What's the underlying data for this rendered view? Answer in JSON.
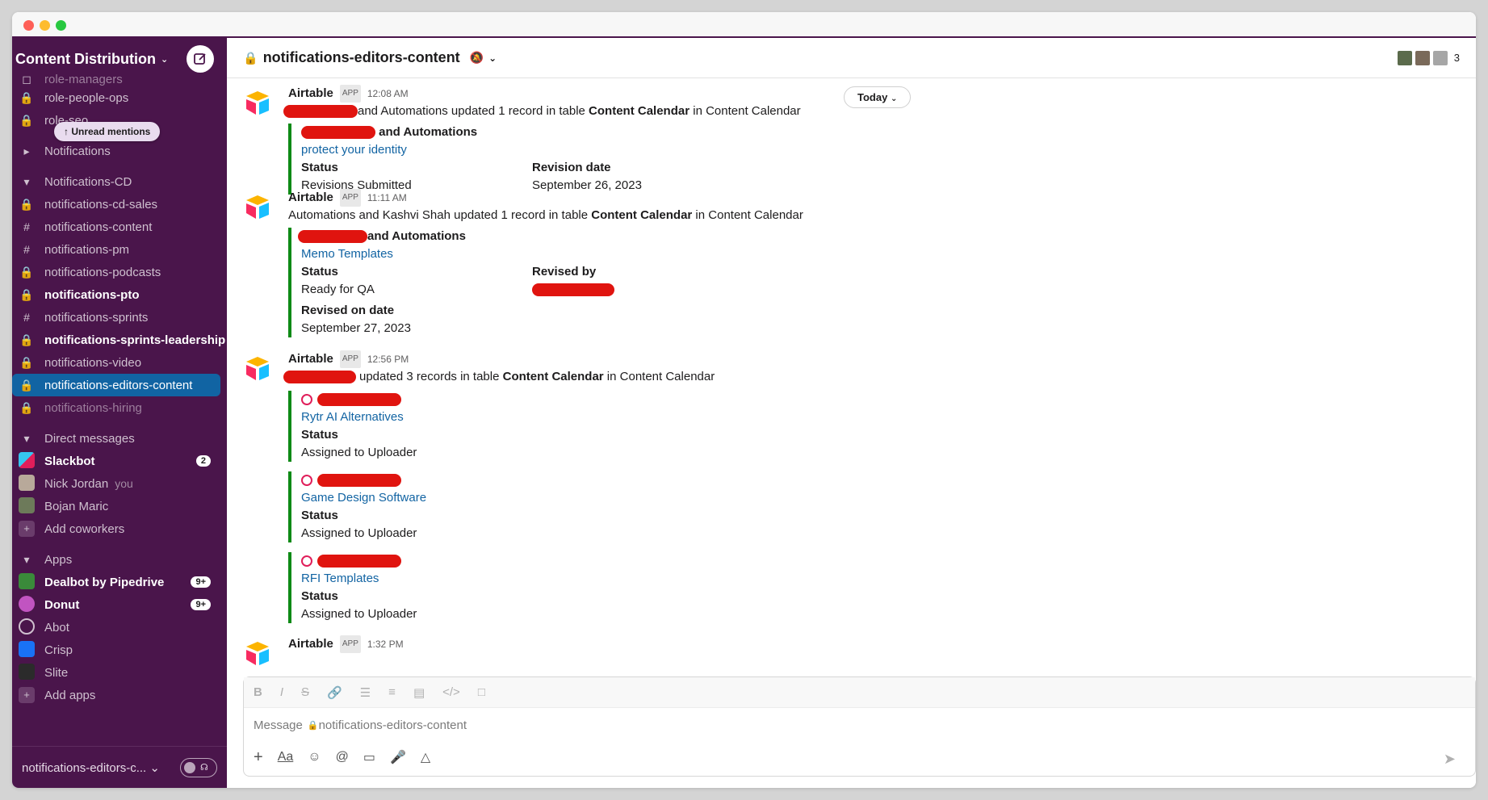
{
  "sidebar": {
    "workspace": "Content Distribution",
    "unread_pill": "Unread mentions",
    "channels_top": [
      {
        "label": "role-managers",
        "icon": "lock"
      },
      {
        "label": "role-people-ops",
        "icon": "lock"
      },
      {
        "label": "role-seo",
        "icon": "lock"
      }
    ],
    "notifications_section": "Notifications",
    "cd_section": "Notifications-CD",
    "cd_channels": [
      {
        "label": "notifications-cd-sales",
        "icon": "lock"
      },
      {
        "label": "notifications-content",
        "icon": "hash"
      },
      {
        "label": "notifications-pm",
        "icon": "hash"
      },
      {
        "label": "notifications-podcasts",
        "icon": "lock"
      },
      {
        "label": "notifications-pto",
        "icon": "lock"
      },
      {
        "label": "notifications-sprints",
        "icon": "hash"
      },
      {
        "label": "notifications-sprints-leadership",
        "icon": "lock"
      },
      {
        "label": "notifications-video",
        "icon": "lock"
      },
      {
        "label": "notifications-editors-content",
        "icon": "lock"
      },
      {
        "label": "notifications-hiring",
        "icon": "lock"
      }
    ],
    "dm_section": "Direct messages",
    "dms": [
      {
        "label": "Slackbot",
        "badge": "2"
      },
      {
        "label": "Nick Jordan",
        "suffix": "you"
      },
      {
        "label": "Bojan Maric"
      },
      {
        "label": "Add coworkers"
      }
    ],
    "apps_section": "Apps",
    "apps": [
      {
        "label": "Dealbot by Pipedrive",
        "badge": "9+"
      },
      {
        "label": "Donut",
        "badge": "9+"
      },
      {
        "label": "Abot"
      },
      {
        "label": "Crisp"
      },
      {
        "label": "Slite"
      },
      {
        "label": "Add apps"
      }
    ],
    "footer_channel": "notifications-editors-c..."
  },
  "header": {
    "channel": "notifications-editors-content",
    "member_count": "3"
  },
  "today": "Today",
  "messages": [
    {
      "sender": "Airtable",
      "tag": "APP",
      "time": "12:08 AM",
      "text_after": "and Automations updated 1 record in table ",
      "table": "Content Calendar",
      "text_in": " in Content Calendar",
      "attach_author_suffix": " and Automations",
      "record": "protect your identity",
      "fields": [
        {
          "label": "Status",
          "value": "Revisions Submitted"
        },
        {
          "label": "Revision date",
          "value": "September 26, 2023"
        }
      ]
    },
    {
      "sender": "Airtable",
      "tag": "APP",
      "time": "11:11 AM",
      "text": "Automations and Kashvi Shah updated 1 record in table ",
      "table": "Content Calendar",
      "text_in": " in Content Calendar",
      "attach_author_suffix": "and Automations",
      "record": "Memo Templates",
      "fields": [
        {
          "label": "Status",
          "value": "Ready for QA"
        },
        {
          "label": "Revised by",
          "value": ""
        }
      ],
      "extra_label": "Revised on date",
      "extra_value": "September 27, 2023"
    },
    {
      "sender": "Airtable",
      "tag": "APP",
      "time": "12:56 PM",
      "text_after": "updated 3 records in table ",
      "table": "Content Calendar",
      "text_in": " in Content Calendar",
      "records": [
        {
          "title": "Rytr AI Alternatives",
          "label": "Status",
          "value": "Assigned to Uploader"
        },
        {
          "title": "Game Design Software",
          "label": "Status",
          "value": "Assigned to Uploader"
        },
        {
          "title": "RFI Templates",
          "label": "Status",
          "value": "Assigned to Uploader"
        }
      ]
    },
    {
      "sender": "Airtable",
      "tag": "APP",
      "time": "1:32 PM"
    }
  ],
  "composer": {
    "placeholder": "Message",
    "channel": "notifications-editors-content"
  }
}
